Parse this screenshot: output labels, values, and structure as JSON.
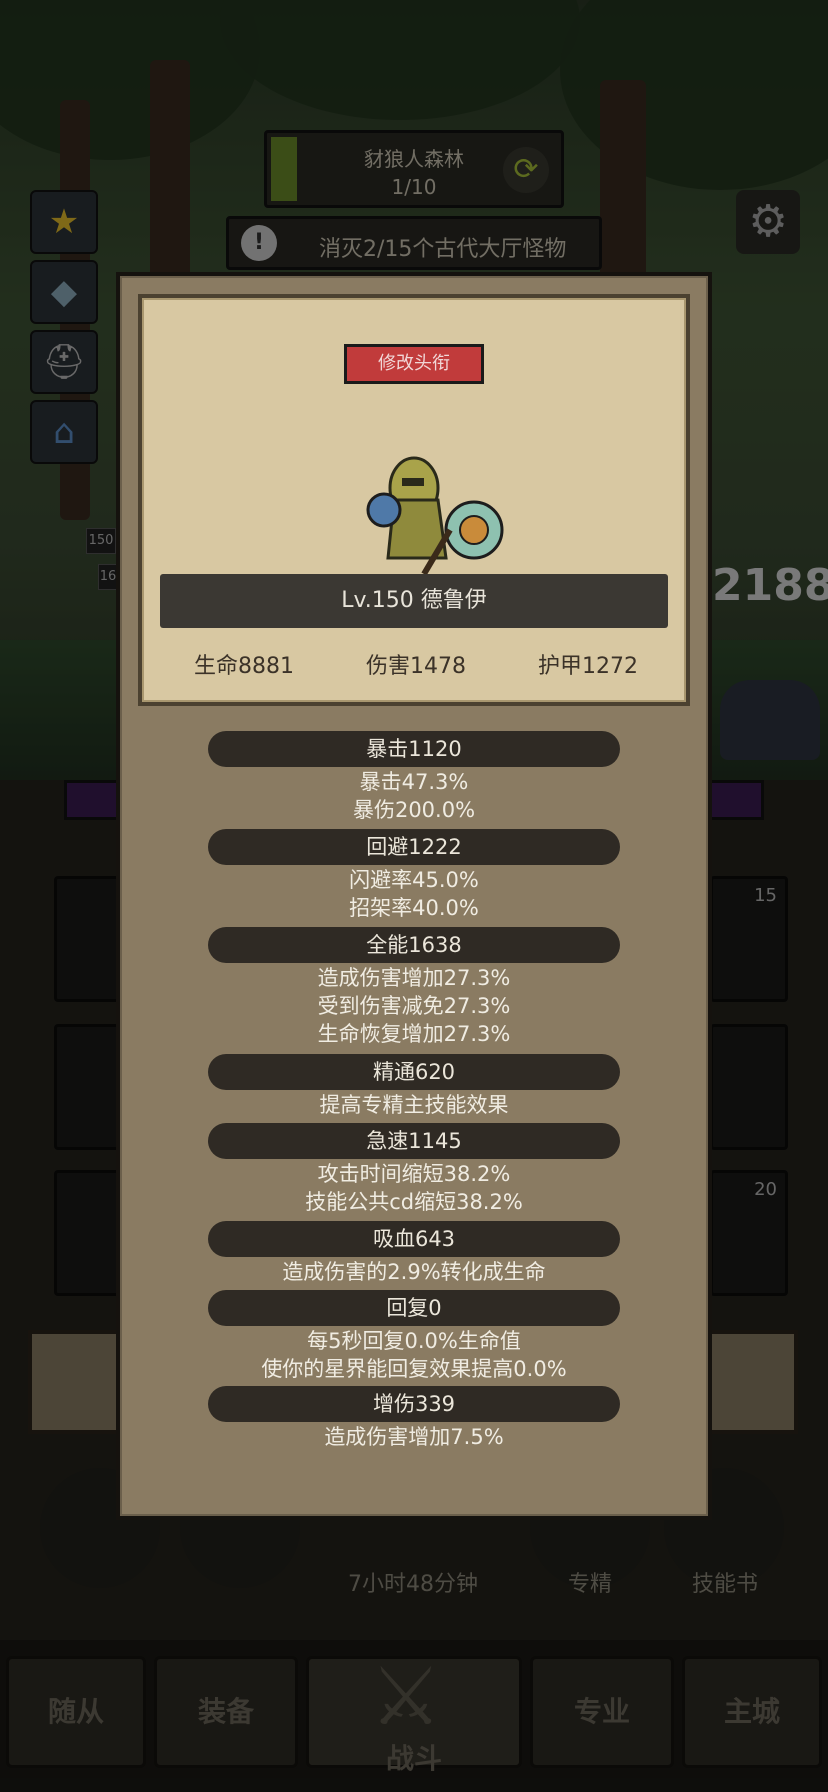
{
  "background": {
    "zone": {
      "name": "豺狼人森林",
      "progress": "1/10"
    },
    "quest": "消灭2/15个古代大厅怪物",
    "level_badges": [
      "150",
      "16"
    ],
    "score_fragment": "2188",
    "slot_numbers": [
      "15",
      "20"
    ],
    "timer": "7小时48分钟",
    "round_labels": [
      "专精",
      "技能书"
    ],
    "tabs": [
      "随从",
      "装备",
      "战斗",
      "专业",
      "主城"
    ]
  },
  "modal": {
    "title_button": "修改头衔",
    "hero_name": "Lv.150 德鲁伊",
    "main_stats": {
      "hp": "生命8881",
      "damage": "伤害1478",
      "armor": "护甲1272"
    },
    "sections": [
      {
        "header": "暴击1120",
        "lines": [
          "暴击47.3%",
          "暴伤200.0%"
        ]
      },
      {
        "header": "回避1222",
        "lines": [
          "闪避率45.0%",
          "招架率40.0%"
        ]
      },
      {
        "header": "全能1638",
        "lines": [
          "造成伤害增加27.3%",
          "受到伤害减免27.3%",
          "生命恢复增加27.3%"
        ]
      },
      {
        "header": "精通620",
        "lines": [
          "提高专精主技能效果"
        ]
      },
      {
        "header": "急速1145",
        "lines": [
          "攻击时间缩短38.2%",
          "技能公共cd缩短38.2%"
        ]
      },
      {
        "header": "吸血643",
        "lines": [
          "造成伤害的2.9%转化成生命"
        ]
      },
      {
        "header": "回复0",
        "lines": [
          "每5秒回复0.0%生命值",
          "使你的星界能回复效果提高0.0%"
        ]
      },
      {
        "header": "增伤339",
        "lines": [
          "造成伤害增加7.5%"
        ]
      }
    ]
  },
  "colors": {
    "modal_bg": "#8a7b62",
    "card_bg": "#d8c8a2",
    "title_button": "#c13b3b",
    "stat_header": "#2f2a24"
  }
}
